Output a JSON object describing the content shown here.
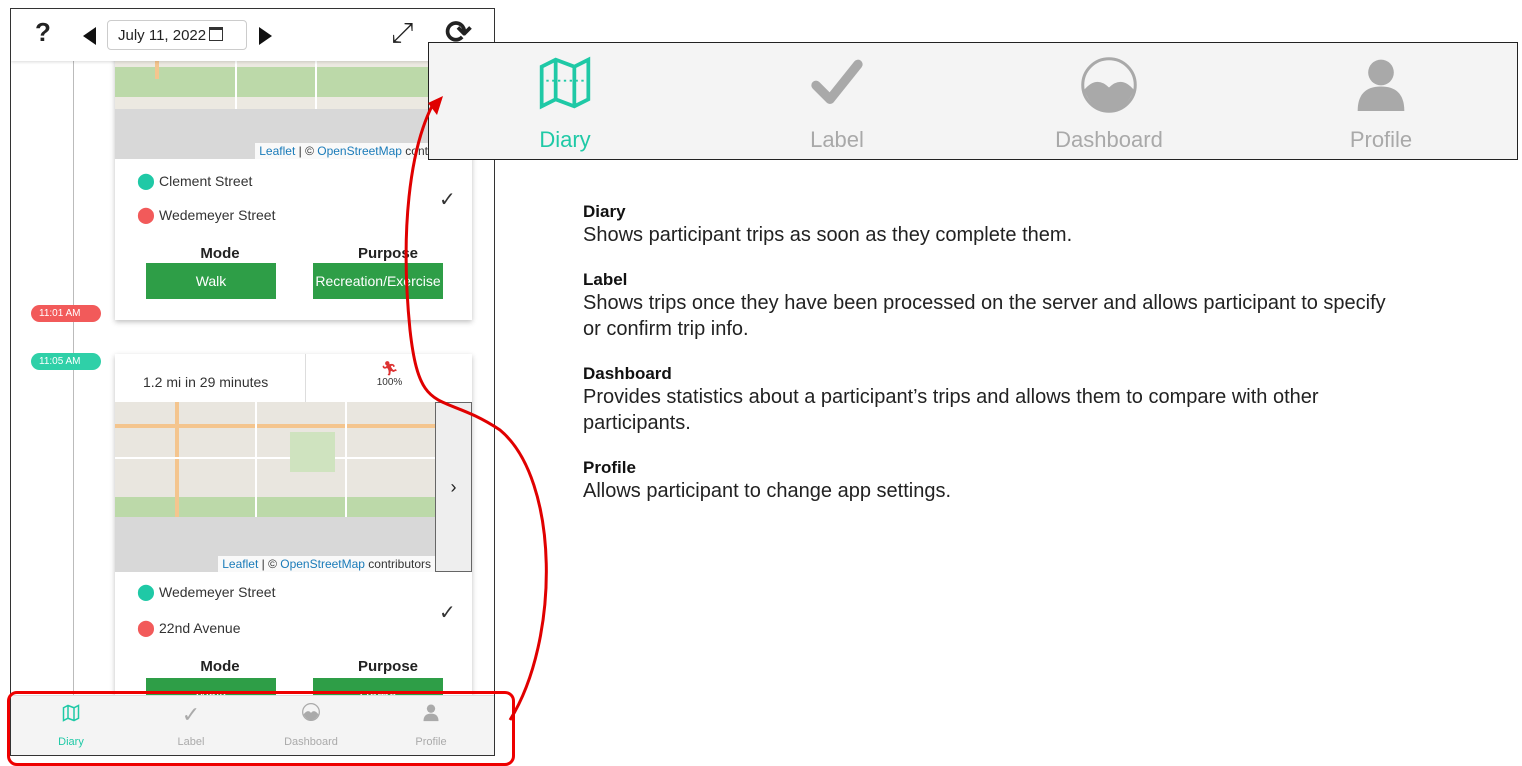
{
  "appbar": {
    "help_label": "?",
    "date": "July 11, 2022"
  },
  "trip1": {
    "attribution_leaflet": "Leaflet",
    "attribution_sep": " | © ",
    "attribution_osm": "OpenStreetMap",
    "attribution_tail": " contributors",
    "start": "Clement Street",
    "end": "Wedemeyer Street",
    "mode_header": "Mode",
    "purpose_header": "Purpose",
    "mode": "Walk",
    "purpose": "Recreation/Exercise",
    "end_time": "11:01 AM"
  },
  "trip2": {
    "start_time": "11:05 AM",
    "summary": "1.2 mi in 29 minutes",
    "mode_pct": "100%",
    "attribution_leaflet": "Leaflet",
    "attribution_sep": " | © ",
    "attribution_osm": "OpenStreetMap",
    "attribution_tail": " contributors",
    "start": "Wedemeyer Street",
    "end": "22nd Avenue",
    "mode_header": "Mode",
    "purpose_header": "Purpose",
    "mode": "Walk",
    "purpose": "Home",
    "detail_chevron": "›"
  },
  "tabs": [
    {
      "label": "Diary",
      "icon": "map-icon",
      "active": true
    },
    {
      "label": "Label",
      "icon": "check-icon",
      "active": false
    },
    {
      "label": "Dashboard",
      "icon": "dashboard-icon",
      "active": false
    },
    {
      "label": "Profile",
      "icon": "profile-icon",
      "active": false
    }
  ],
  "descriptions": [
    {
      "title": "Diary",
      "text": "Shows participant trips as soon as they complete them."
    },
    {
      "title": "Label",
      "text": "Shows trips once they have been processed on the server and allows participant to specify or confirm trip info."
    },
    {
      "title": "Dashboard",
      "text": "Provides statistics about a participant’s trips and allows them to compare with other participants."
    },
    {
      "title": "Profile",
      "text": "Allows participant to change app settings."
    }
  ],
  "colors": {
    "accent": "#1fc9a6",
    "inactive": "#a9a9a9",
    "button_green": "#2e9e47",
    "badge_end": "#f25a5a",
    "badge_start": "#2fd0a8",
    "highlight": "#e00000"
  }
}
